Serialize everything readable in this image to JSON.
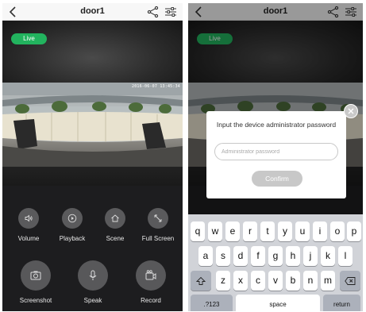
{
  "left": {
    "navbar": {
      "title": "door1"
    },
    "live_label": "Live",
    "osd_text": "2016-06-07 13:45:34",
    "controls": {
      "volume": "Volume",
      "playback": "Playback",
      "scene": "Scene",
      "full_screen": "Full Screen",
      "screenshot": "Screenshot",
      "speak": "Speak",
      "record": "Record"
    }
  },
  "right": {
    "navbar": {
      "title": "door1"
    },
    "live_label": "Live",
    "dialog": {
      "title": "Input the device administrator password",
      "password_placeholder": "Administrator password",
      "password_value": "",
      "confirm_label": "Confirm"
    },
    "keyboard": {
      "row1": [
        "q",
        "w",
        "e",
        "r",
        "t",
        "y",
        "u",
        "i",
        "o",
        "p"
      ],
      "row2": [
        "a",
        "s",
        "d",
        "f",
        "g",
        "h",
        "j",
        "k",
        "l"
      ],
      "row3": [
        "z",
        "x",
        "c",
        "v",
        "b",
        "n",
        "m"
      ],
      "numbers_label": ".?123",
      "space_label": "space",
      "return_label": "return"
    }
  },
  "colors": {
    "live_green": "#22b35e",
    "control_bg": "#1d1d1f",
    "control_button": "#5a5a5c",
    "confirm_disabled": "#c8c8c8",
    "keyboard_bg": "#d1d3d8"
  },
  "icons": [
    "back-chevron-icon",
    "share-icon",
    "settings-sliders-icon",
    "volume-icon",
    "playback-icon",
    "scene-icon",
    "fullscreen-icon",
    "screenshot-icon",
    "microphone-icon",
    "record-camera-icon",
    "close-icon",
    "shift-icon",
    "backspace-icon"
  ]
}
